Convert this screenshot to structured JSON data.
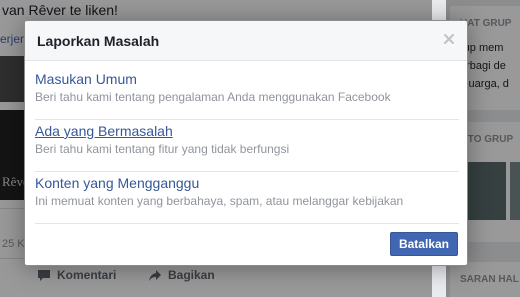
{
  "background": {
    "heading": "van Rêver te liken!",
    "link_fragment": "erjer",
    "thumb_text": "Rêver",
    "count_fragment": "25 K",
    "actions": {
      "comment": "Komentari",
      "share": "Bagikan"
    },
    "right_cards": [
      {
        "title": "UAT GRUP",
        "lines": [
          "rup mem",
          "erbagi de",
          "eluarga, d"
        ]
      },
      {
        "title": "OTO GRUP",
        "lines": []
      },
      {
        "title": "SARAN HAL",
        "lines": []
      }
    ]
  },
  "dialog": {
    "title": "Laporkan Masalah",
    "close_icon": "close-icon",
    "items": [
      {
        "title": "Masukan Umum",
        "description": "Beri tahu kami tentang pengalaman Anda menggunakan Facebook",
        "hovered": false
      },
      {
        "title": "Ada yang Bermasalah",
        "description": "Beri tahu kami tentang fitur yang tidak berfungsi",
        "hovered": true
      },
      {
        "title": "Konten yang Mengganggu",
        "description": "Ini memuat konten yang berbahaya, spam, atau melanggar kebijakan",
        "hovered": false
      }
    ],
    "cancel_label": "Batalkan"
  },
  "colors": {
    "link": "#365899",
    "button": "#4267b2",
    "muted_text": "#90949c"
  }
}
